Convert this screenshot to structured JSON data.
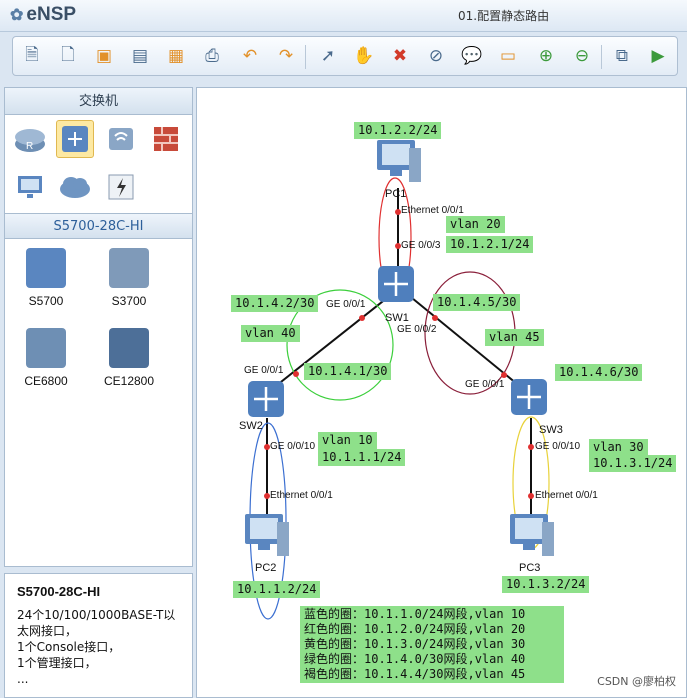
{
  "app": {
    "name": "eNSP",
    "document_title": "01.配置静态路由"
  },
  "toolbar": {
    "icons": [
      "new-topology-icon",
      "new-page-icon",
      "open-icon",
      "save-icon",
      "save-as-icon",
      "print-icon",
      "undo-icon",
      "redo-icon",
      "select-icon",
      "pan-hand-icon",
      "delete-icon",
      "delete-link-icon",
      "text-icon",
      "rectangle-icon",
      "zoom-in-icon",
      "zoom-out-icon",
      "fit-icon",
      "start-all-icon"
    ]
  },
  "left_panel": {
    "category_title": "交换机",
    "category_icons": [
      "router-icon",
      "switch-icon",
      "wireless-icon",
      "firewall-icon",
      "pc-icon",
      "cloud-icon",
      "other-device-icon"
    ],
    "model_group": "S5700-28C-HI",
    "models": [
      "S5700",
      "S3700",
      "CE6800",
      "CE12800"
    ]
  },
  "description": {
    "title": "S5700-28C-HI",
    "lines": [
      "24个10/100/1000BASE-T以",
      "太网接口，",
      "1个Console接口，",
      "1个管理接口，",
      "..."
    ]
  },
  "topology": {
    "devices": {
      "pc1": "PC1",
      "sw1": "SW1",
      "sw2": "SW2",
      "sw3": "SW3",
      "pc2": "PC2",
      "pc3": "PC3"
    },
    "ports": {
      "pc1_eth": "Ethernet 0/0/1",
      "sw1_g3": "GE 0/0/3",
      "sw1_g1": "GE 0/0/1",
      "sw1_g2": "GE 0/0/2",
      "sw2_g1": "GE 0/0/1",
      "sw2_g10": "GE 0/0/10",
      "pc2_eth": "Ethernet 0/0/1",
      "sw3_g1": "GE 0/0/1",
      "sw3_g10": "GE 0/0/10",
      "pc3_eth": "Ethernet 0/0/1"
    },
    "labels": {
      "pc1_ip": "10.1.2.2/24",
      "vlan20": "vlan 20",
      "sw1_vlanif20": "10.1.2.1/24",
      "sw1_ip40": "10.1.4.2/30",
      "sw1_ip45": "10.1.4.5/30",
      "vlan40": "vlan 40",
      "vlan45": "vlan 45",
      "sw2_ip40": "10.1.4.1/30",
      "sw3_ip45": "10.1.4.6/30",
      "vlan10": "vlan 10",
      "sw2_vlanif10": "10.1.1.1/24",
      "vlan30": "vlan 30",
      "sw3_vlanif30": "10.1.3.1/24",
      "pc2_ip": "10.1.1.2/24",
      "pc3_ip": "10.1.3.2/24"
    },
    "legend": [
      "蓝色的圈：10.1.1.0/24网段,vlan 10",
      "红色的圈：10.1.2.0/24网段,vlan 20",
      "黄色的圈：10.1.3.0/24网段,vlan 30",
      "绿色的圈：10.1.4.0/30网段,vlan 40",
      "褐色的圈：10.1.4.4/30网段,vlan 45"
    ],
    "colors": {
      "blue": "#3b6fd1",
      "red": "#e03030",
      "yellow": "#e8d23a",
      "green": "#3ccf3c",
      "brown": "#8a1f3a",
      "label_bg": "#8ee08a"
    }
  },
  "watermark": "CSDN @廖柏权"
}
